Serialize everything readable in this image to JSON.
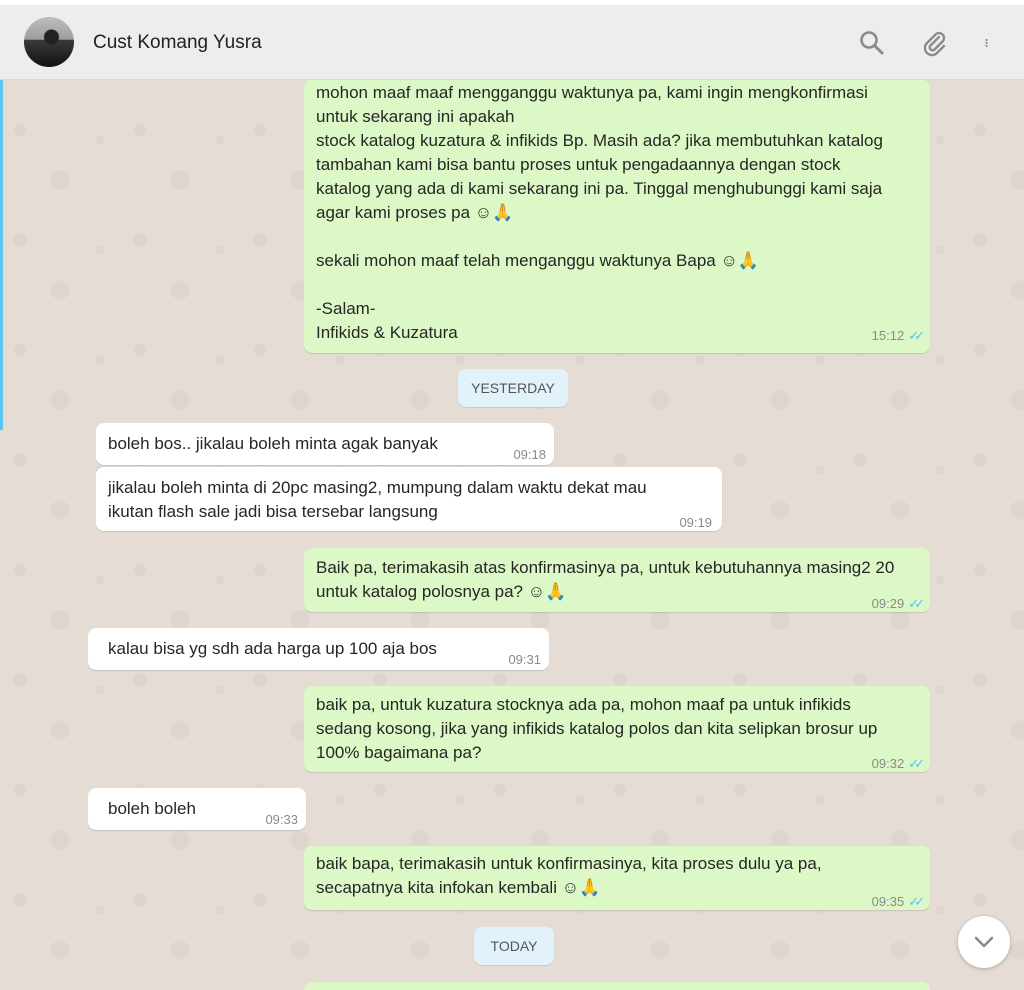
{
  "header": {
    "contact_name": "Cust Komang Yusra",
    "icons": [
      "search-icon",
      "attach-icon",
      "menu-icon"
    ]
  },
  "colors": {
    "outgoing": "#dcf8c6",
    "incoming": "#ffffff",
    "read_tick": "#4fc3f7",
    "chip": "#e1f2fb"
  },
  "messages": {
    "m1": {
      "lines": [
        "mohon maaf maaf mengganggu waktunya pa, kami ingin mengkonfirmasi",
        "untuk sekarang ini apakah",
        "stock katalog kuzatura & infikids Bp. Masih ada? jika membutuhkan katalog",
        "tambahan kami bisa bantu proses untuk pengadaannya dengan stock",
        "katalog yang ada di kami sekarang ini pa. Tinggal menghubunggi kami saja",
        "agar kami proses pa ☺🙏",
        "",
        "sekali mohon maaf telah menganggu waktunya Bapa ☺🙏",
        "",
        "-Salam-",
        "Infikids & Kuzatura"
      ],
      "time": "15:12"
    },
    "chip_yesterday": "YESTERDAY",
    "m2": {
      "text": "boleh bos.. jikalau boleh minta agak banyak",
      "time": "09:18"
    },
    "m3": {
      "line1": "jikalau boleh minta di 20pc masing2, mumpung dalam waktu dekat mau",
      "line2": "ikutan flash sale jadi bisa tersebar langsung",
      "time": "09:19"
    },
    "m4": {
      "line1": "Baik pa,  terimakasih atas konfirmasinya pa,  untuk kebutuhannya masing2 20",
      "line2": "untuk katalog polosnya pa? ☺🙏",
      "time": "09:29"
    },
    "m5": {
      "text": "kalau bisa yg sdh ada harga up 100 aja bos",
      "time": "09:31"
    },
    "m6": {
      "line1": "baik pa, untuk kuzatura stocknya ada pa, mohon maaf pa untuk infikids",
      "line2": "sedang kosong, jika yang infikids katalog polos dan kita selipkan brosur up",
      "line3": "100% bagaimana pa?",
      "time": "09:32"
    },
    "m7": {
      "text": "boleh boleh",
      "time": "09:33"
    },
    "m8": {
      "line1": "baik bapa, terimakasih untuk konfirmasinya, kita proses dulu ya pa,",
      "line2": "secapatnya kita infokan kembali ☺🙏",
      "time": "09:35"
    },
    "chip_today": "TODAY"
  }
}
